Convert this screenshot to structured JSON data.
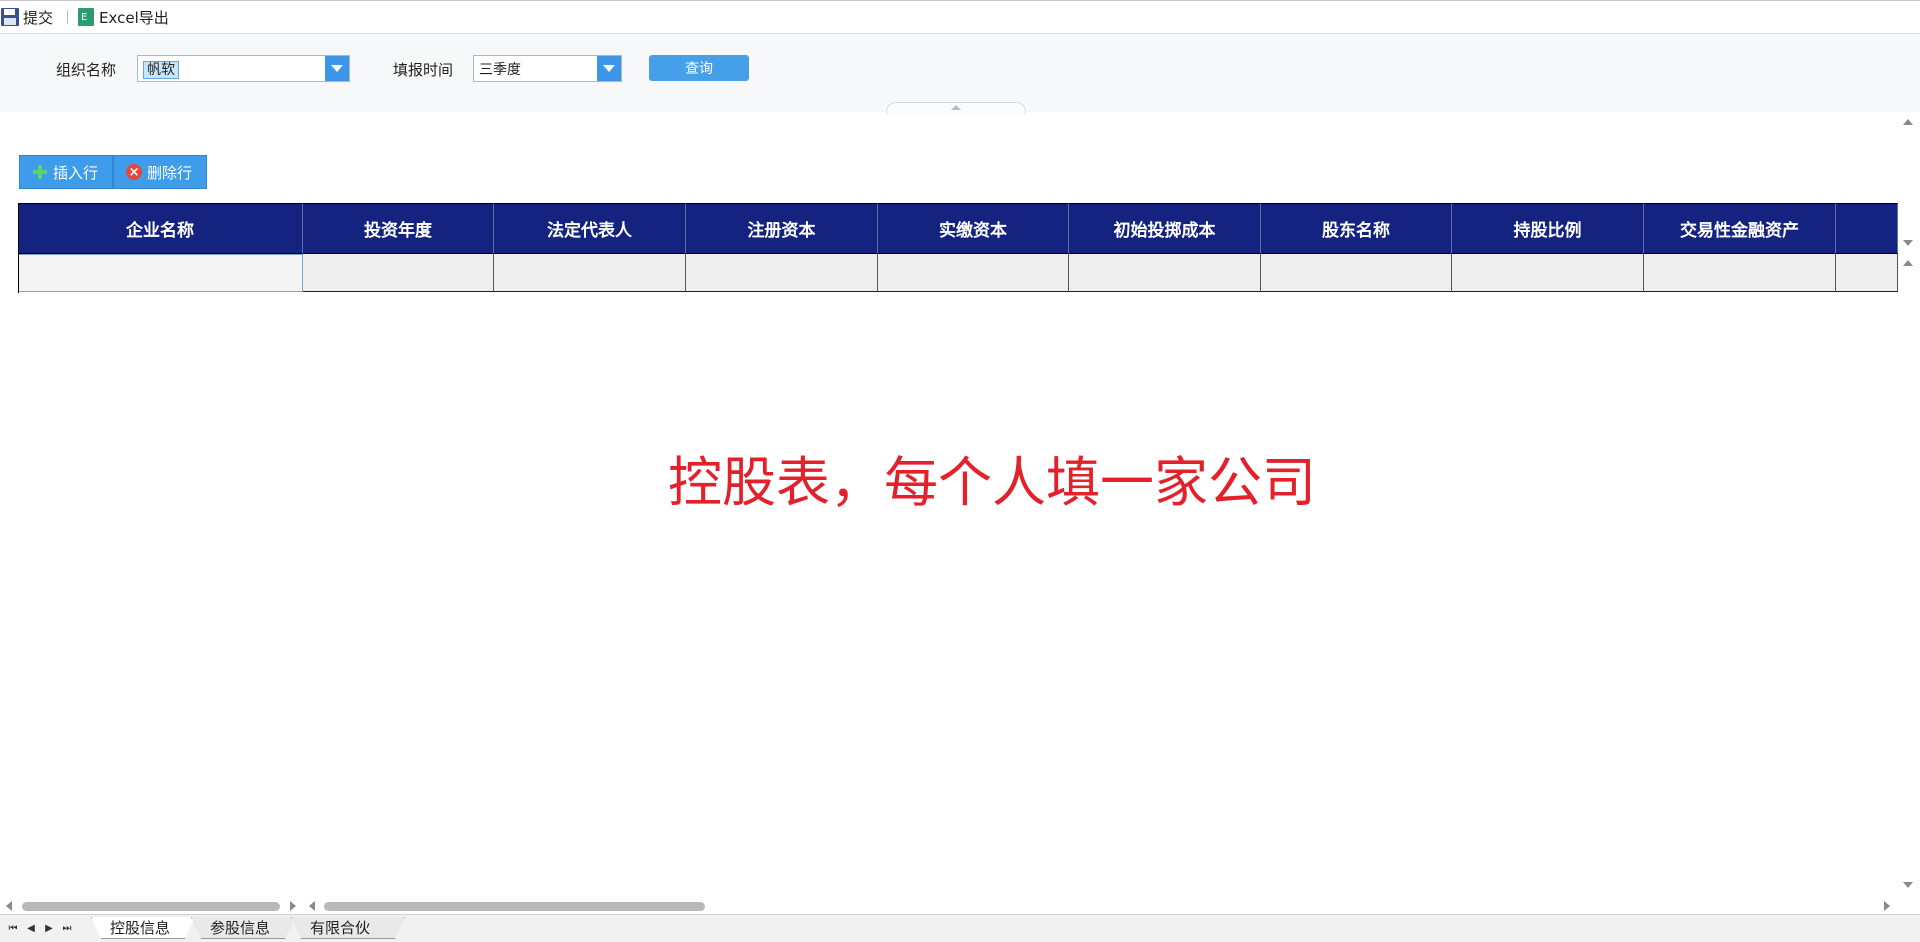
{
  "toolbar": {
    "submit_label": "提交",
    "export_label": "Excel导出"
  },
  "filters": {
    "org_label": "组织名称",
    "org_value": "帆软",
    "time_label": "填报时间",
    "time_value": "三季度",
    "query_label": "查询"
  },
  "row_actions": {
    "insert_label": "插入行",
    "delete_label": "删除行"
  },
  "table": {
    "columns": [
      "企业名称",
      "投资年度",
      "法定代表人",
      "注册资本",
      "实缴资本",
      "初始投掷成本",
      "股东名称",
      "持股比例",
      "交易性金融资产"
    ]
  },
  "annotation": "控股表，每个人填一家公司",
  "sheets": {
    "tabs": [
      "控股信息",
      "参股信息",
      "有限合伙"
    ],
    "active_index": 0
  }
}
